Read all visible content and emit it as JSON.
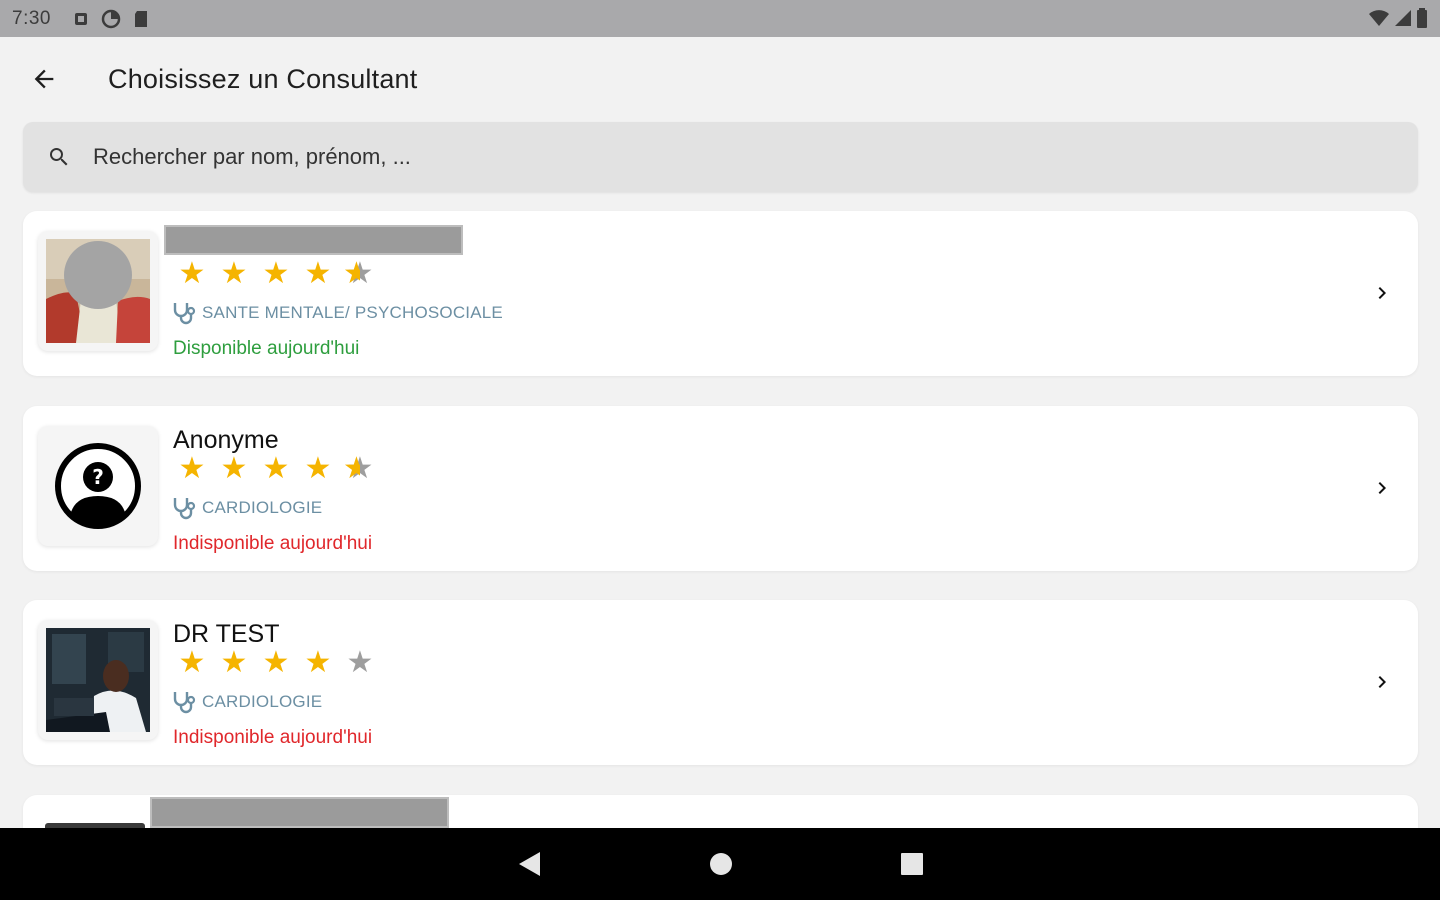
{
  "status_bar": {
    "time": "7:30"
  },
  "header": {
    "title": "Choisissez un Consultant"
  },
  "search": {
    "placeholder": "Rechercher par nom, prénom, ..."
  },
  "consultants": [
    {
      "name": "",
      "rating": 4.5,
      "specialty": "SANTE MENTALE/ PSYCHOSOCIALE",
      "availability": "Disponible aujourd'hui",
      "available": true,
      "avatar": "photo-blurred"
    },
    {
      "name": "Anonyme",
      "rating": 4.5,
      "specialty": "CARDIOLOGIE",
      "availability": "Indisponible aujourd'hui",
      "available": false,
      "avatar": "anonymous-user-icon"
    },
    {
      "name": "DR TEST",
      "rating": 4,
      "specialty": "CARDIOLOGIE",
      "availability": "Indisponible aujourd'hui",
      "available": false,
      "avatar": "doctor-photo"
    }
  ],
  "colors": {
    "star": "#f5b400",
    "available": "#2e9e3e",
    "unavailable": "#e0272b",
    "specialty": "#6c8fa3"
  },
  "icons": [
    "back-arrow-icon",
    "search-icon",
    "stethoscope-icon",
    "chevron-right-icon",
    "nav-back-icon",
    "nav-home-icon",
    "nav-recents-icon"
  ]
}
